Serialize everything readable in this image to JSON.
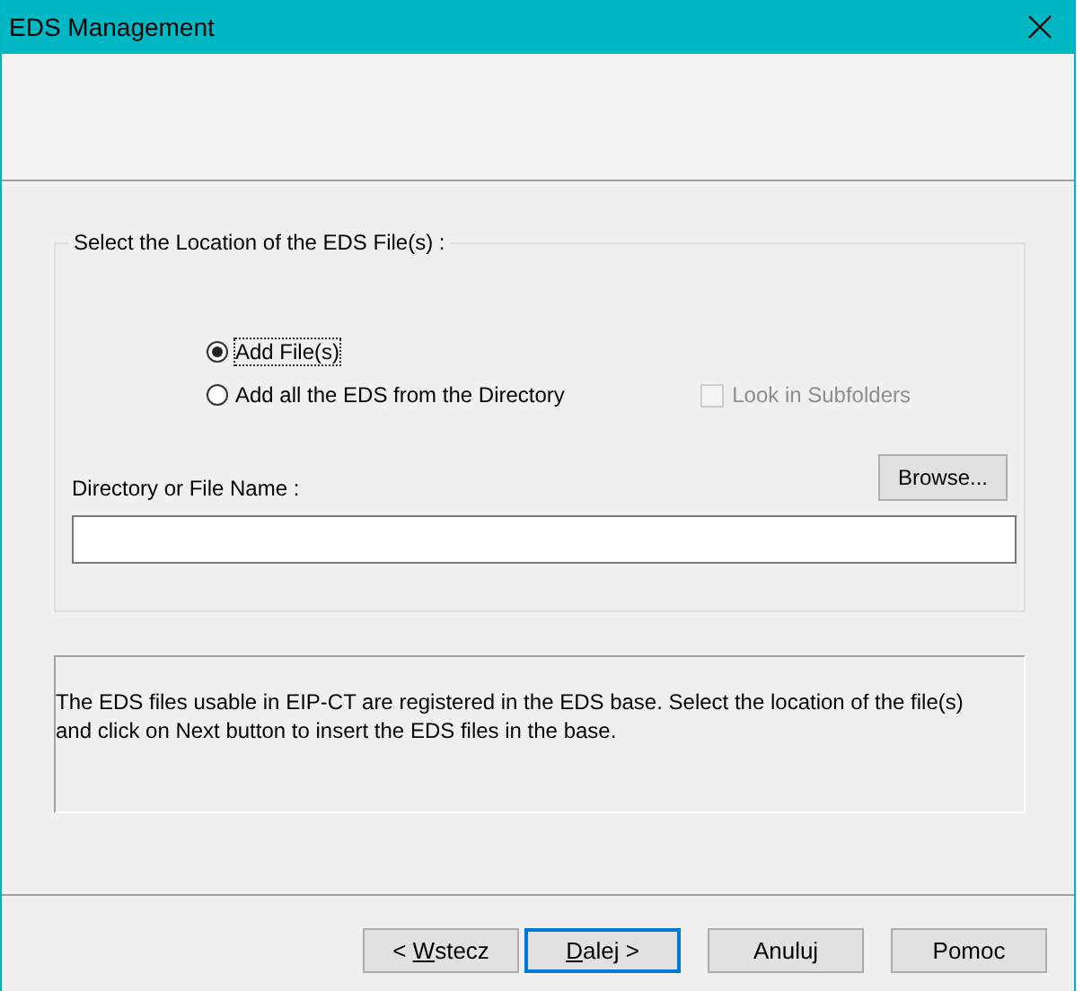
{
  "window": {
    "title": "EDS Management"
  },
  "location_group": {
    "legend": "Select the Location of the EDS File(s) :",
    "options": [
      {
        "label": "Add File(s)",
        "selected": true,
        "focused": true
      },
      {
        "label": "Add all the EDS from the Directory",
        "selected": false,
        "focused": false
      }
    ],
    "subfolders": {
      "label": "Look in Subfolders",
      "checked": false,
      "disabled": true
    },
    "path_label": "Directory or File Name :",
    "browse_button": "Browse..."
  },
  "description": "The EDS files usable in EIP-CT are registered in the EDS base. Select the location of the file(s) and click on Next button to insert the EDS files in the base.",
  "buttons": [
    {
      "before": "< ",
      "key": "W",
      "after": "stecz",
      "default": false
    },
    {
      "key": "D",
      "after": "alej >",
      "default": true
    },
    {
      "after": "Anuluj",
      "default": false
    },
    {
      "after": "Pomoc",
      "default": false
    }
  ]
}
